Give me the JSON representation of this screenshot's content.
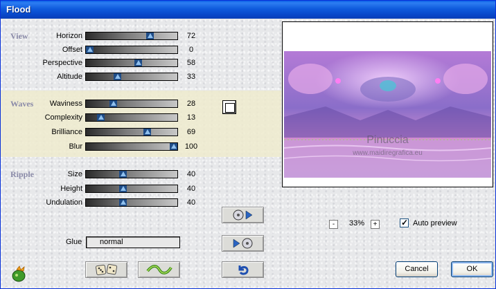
{
  "window": {
    "title": "Flood"
  },
  "sections": {
    "view": "View",
    "waves": "Waves",
    "ripple": "Ripple"
  },
  "sliders": [
    {
      "label": "Horizon",
      "value": "72",
      "level": 72
    },
    {
      "label": "Offset",
      "value": "0",
      "level": 0
    },
    {
      "label": "Perspective",
      "value": "58",
      "level": 58
    },
    {
      "label": "Altitude",
      "value": "33",
      "level": 33
    },
    {
      "label": "Waviness",
      "value": "28",
      "level": 28
    },
    {
      "label": "Complexity",
      "value": "13",
      "level": 13
    },
    {
      "label": "Brilliance",
      "value": "69",
      "level": 69
    },
    {
      "label": "Blur",
      "value": "100",
      "level": 100
    },
    {
      "label": "Size",
      "value": "40",
      "level": 40
    },
    {
      "label": "Height",
      "value": "40",
      "level": 40
    },
    {
      "label": "Undulation",
      "value": "40",
      "level": 40
    }
  ],
  "glue": {
    "label": "Glue",
    "value": "normal"
  },
  "preview": {
    "watermark_name": "Pinuccia",
    "watermark_url": "www.maidiregrafica.eu"
  },
  "zoom": {
    "minus": "-",
    "value": "33%",
    "plus": "+"
  },
  "auto_preview": {
    "label": "Auto preview",
    "checked": true
  },
  "buttons": {
    "cancel": "Cancel",
    "ok": "OK"
  },
  "colors": {
    "titlebar": "#0a5ee6",
    "slider_thumb": "#1f4c86",
    "waves_band": "#eeebce"
  }
}
